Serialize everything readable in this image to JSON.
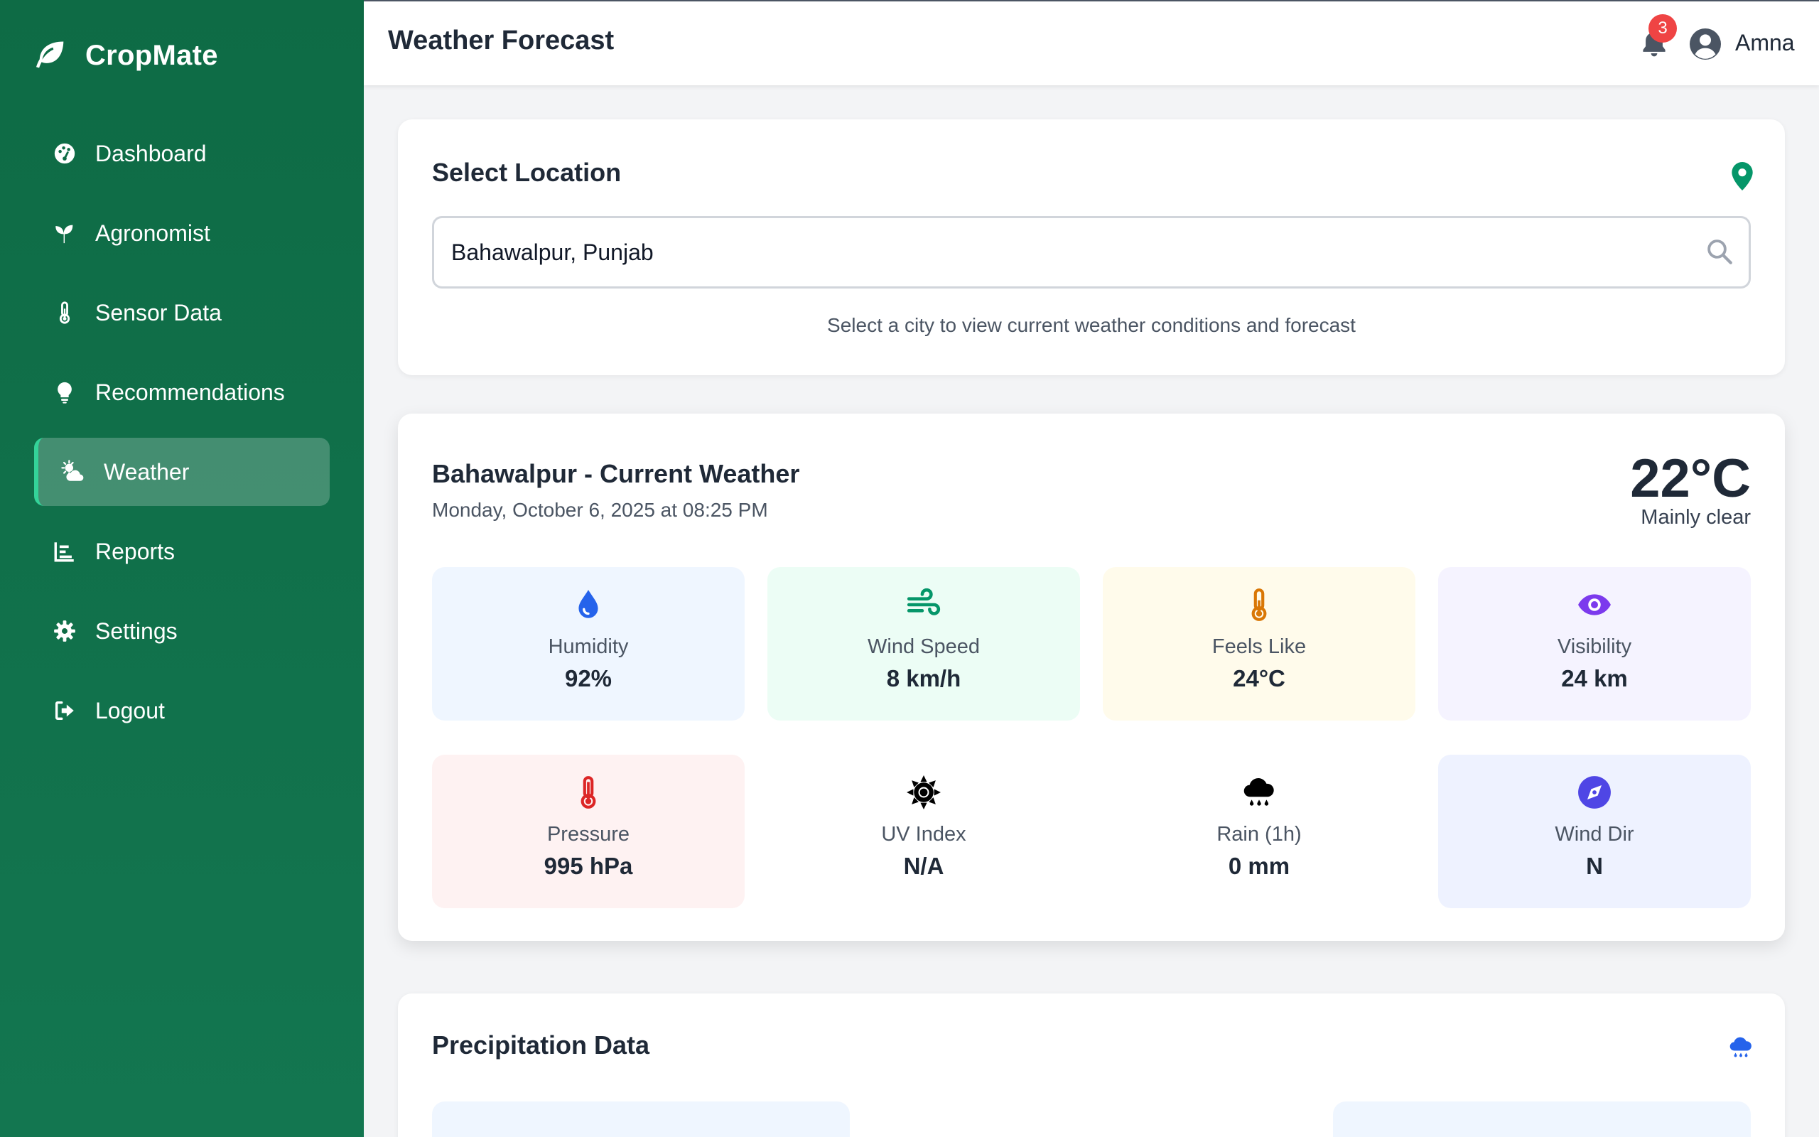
{
  "app": {
    "name": "CropMate"
  },
  "sidebar": {
    "items": [
      {
        "label": "Dashboard",
        "icon": "palette-gauge-icon",
        "active": false
      },
      {
        "label": "Agronomist",
        "icon": "seedling-icon",
        "active": false
      },
      {
        "label": "Sensor Data",
        "icon": "thermometer-icon",
        "active": false
      },
      {
        "label": "Recommendations",
        "icon": "lightbulb-icon",
        "active": false
      },
      {
        "label": "Weather",
        "icon": "cloud-sun-icon",
        "active": true
      },
      {
        "label": "Reports",
        "icon": "bar-chart-icon",
        "active": false
      },
      {
        "label": "Settings",
        "icon": "gear-icon",
        "active": false
      },
      {
        "label": "Logout",
        "icon": "sign-out-icon",
        "active": false
      }
    ]
  },
  "header": {
    "title": "Weather Forecast",
    "notifications": "3",
    "user": "Amna"
  },
  "location": {
    "title": "Select Location",
    "value": "Bahawalpur, Punjab",
    "hint": "Select a city to view current weather conditions and forecast"
  },
  "current": {
    "title": "Bahawalpur - Current Weather",
    "date": "Monday, October 6, 2025 at 08:25 PM",
    "temp": "22°C",
    "condition": "Mainly clear",
    "metrics": [
      {
        "label": "Humidity",
        "value": "92%",
        "icon": "droplet-icon",
        "bg": "#eff6ff",
        "color": "#2563eb"
      },
      {
        "label": "Wind Speed",
        "value": "8 km/h",
        "icon": "wind-icon",
        "bg": "#ecfdf5",
        "color": "#059669"
      },
      {
        "label": "Feels Like",
        "value": "24°C",
        "icon": "thermometer-half-icon",
        "bg": "#fffbeb",
        "color": "#d97706"
      },
      {
        "label": "Visibility",
        "value": "24 km",
        "icon": "eye-icon",
        "bg": "#f5f3ff",
        "color": "#7c3aed"
      },
      {
        "label": "Pressure",
        "value": "995 hPa",
        "icon": "thermometer-full-icon",
        "bg": "#fef2f2",
        "color": "#dc2626"
      },
      {
        "label": "UV Index",
        "value": "N/A",
        "icon": "sun-icon",
        "bg": "#ffffff",
        "color": "#000000"
      },
      {
        "label": "Rain (1h)",
        "value": "0 mm",
        "icon": "cloud-rain-icon",
        "bg": "#ffffff",
        "color": "#000000"
      },
      {
        "label": "Wind Dir",
        "value": "N",
        "icon": "compass-icon",
        "bg": "#eef2ff",
        "color": "#4f46e5"
      }
    ]
  },
  "precipitation": {
    "title": "Precipitation Data",
    "icon": "cloud-rain-icon",
    "icon_color": "#2563eb"
  },
  "colors": {
    "sidebar": "#0e6b45",
    "accent": "#34d399",
    "badge": "#ef4444"
  }
}
